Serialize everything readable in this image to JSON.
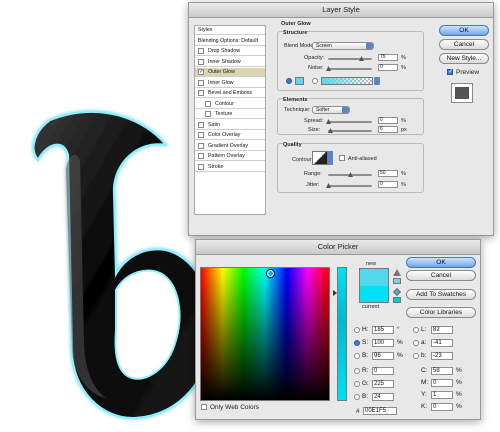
{
  "layer_style": {
    "title": "Layer Style",
    "styles_list": [
      {
        "label": "Styles",
        "header": true
      },
      {
        "label": "Blending Options: Default",
        "header": true
      },
      {
        "label": "Drop Shadow",
        "checked": false
      },
      {
        "label": "Inner Shadow",
        "checked": false
      },
      {
        "label": "Outer Glow",
        "checked": true,
        "selected": true
      },
      {
        "label": "Inner Glow",
        "checked": false
      },
      {
        "label": "Bevel and Emboss",
        "checked": false
      },
      {
        "label": "Contour",
        "checked": false,
        "sub": true
      },
      {
        "label": "Texture",
        "checked": false,
        "sub": true
      },
      {
        "label": "Satin",
        "checked": false
      },
      {
        "label": "Color Overlay",
        "checked": false
      },
      {
        "label": "Gradient Overlay",
        "checked": false
      },
      {
        "label": "Pattern Overlay",
        "checked": false
      },
      {
        "label": "Stroke",
        "checked": false
      }
    ],
    "section_title": "Outer Glow",
    "structure": {
      "title": "Structure",
      "blend_mode_label": "Blend Mode:",
      "blend_mode": "Screen",
      "opacity_label": "Opacity:",
      "opacity": "75",
      "noise_label": "Noise:",
      "noise": "0",
      "percent": "%",
      "glow_color": "#5fd6ec"
    },
    "elements": {
      "title": "Elements",
      "technique_label": "Technique:",
      "technique": "Softer",
      "spread_label": "Spread:",
      "spread": "0",
      "size_label": "Size:",
      "size": "6",
      "px": "px"
    },
    "quality": {
      "title": "Quality",
      "contour_label": "Contour:",
      "anti_aliased": "Anti-aliased",
      "range_label": "Range:",
      "range": "50",
      "jitter_label": "Jitter:",
      "jitter": "0"
    },
    "buttons": {
      "ok": "OK",
      "cancel": "Cancel",
      "new_style": "New Style...",
      "preview": "Preview"
    }
  },
  "color_picker": {
    "title": "Color Picker",
    "new_label": "new",
    "current_label": "current",
    "new_color": "#51d8ea",
    "current_color": "#00e1f5",
    "buttons": {
      "ok": "OK",
      "cancel": "Cancel",
      "add_to_swatches": "Add To Swatches",
      "color_libraries": "Color Libraries"
    },
    "hsb": [
      {
        "label": "H:",
        "value": "185",
        "unit": "°",
        "selected": false
      },
      {
        "label": "S:",
        "value": "100",
        "unit": "%",
        "selected": true
      },
      {
        "label": "B:",
        "value": "96",
        "unit": "%",
        "selected": false
      }
    ],
    "rgb": [
      {
        "label": "R:",
        "value": "0"
      },
      {
        "label": "G:",
        "value": "225"
      },
      {
        "label": "B:",
        "value": "24"
      }
    ],
    "lab": [
      {
        "label": "L:",
        "value": "82"
      },
      {
        "label": "a:",
        "value": "-41"
      },
      {
        "label": "b:",
        "value": "-23"
      }
    ],
    "cmyk": [
      {
        "label": "C:",
        "value": "58",
        "unit": "%"
      },
      {
        "label": "M:",
        "value": "0",
        "unit": "%"
      },
      {
        "label": "Y:",
        "value": "1",
        "unit": "%"
      },
      {
        "label": "K:",
        "value": "0",
        "unit": "%"
      }
    ],
    "hex_label": "#",
    "hex": "00E1F5",
    "only_web_colors": "Only Web Colors"
  },
  "artwork": {
    "letter": "b"
  }
}
